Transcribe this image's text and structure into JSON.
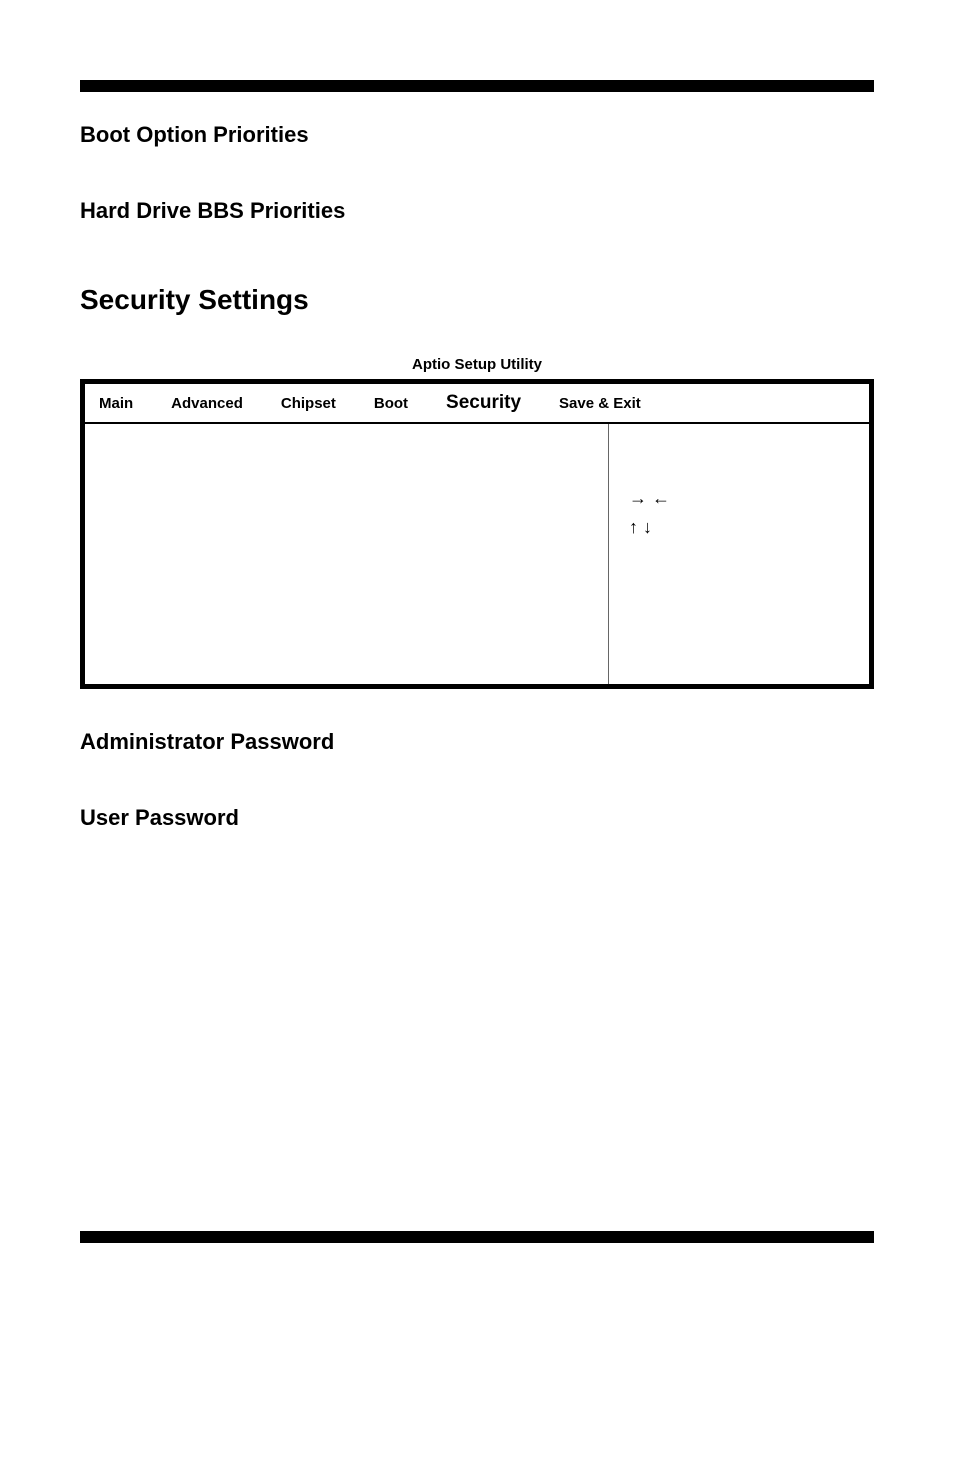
{
  "headings": {
    "boot_option": "Boot Option Priorities",
    "hard_drive": "Hard Drive BBS Priorities",
    "section": "Security Settings",
    "admin_pw": "Administrator Password",
    "user_pw": "User Password"
  },
  "bios": {
    "caption": "Aptio Setup Utility",
    "tabs": {
      "main": "Main",
      "advanced": "Advanced",
      "chipset": "Chipset",
      "boot": "Boot",
      "security": "Security",
      "save_exit": "Save & Exit"
    },
    "arrows": {
      "lr": "→  ←",
      "ud": "↑  ↓"
    }
  }
}
